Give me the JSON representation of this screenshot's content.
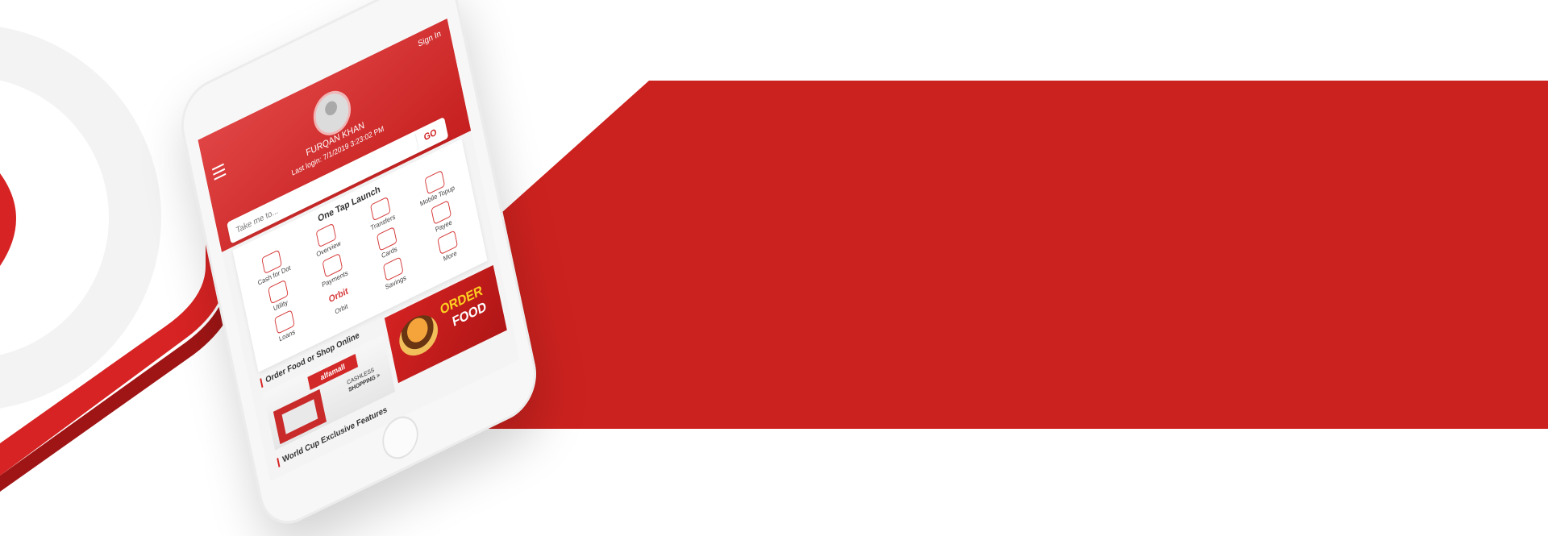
{
  "app": {
    "sign_in": "Sign In",
    "user_name": "FURQAN KHAN",
    "last_login": "Last login: 7/1/2019 3:23:02 PM"
  },
  "search": {
    "placeholder": "Take me to...",
    "go_label": "GO"
  },
  "launch": {
    "title": "One Tap Launch",
    "items": [
      {
        "label": "Cash for Dot",
        "icon": "cash-icon"
      },
      {
        "label": "Overview",
        "icon": "overview-icon"
      },
      {
        "label": "Transfers",
        "icon": "transfers-icon"
      },
      {
        "label": "Mobile Topup",
        "icon": "mobile-topup-icon"
      },
      {
        "label": "Utility",
        "icon": "utility-icon"
      },
      {
        "label": "Payments",
        "icon": "payments-icon"
      },
      {
        "label": "Cards",
        "icon": "cards-icon"
      },
      {
        "label": "Payee",
        "icon": "payee-icon"
      },
      {
        "label": "Loans",
        "icon": "loans-icon"
      },
      {
        "label": "Orbit",
        "icon": "orbit-icon",
        "icon_text": "Orbit"
      },
      {
        "label": "Savings",
        "icon": "savings-icon"
      },
      {
        "label": "More",
        "icon": "more-icon"
      }
    ]
  },
  "sections": {
    "order_food": "Order Food or Shop Online",
    "world_cup": "World Cup Exclusive Features"
  },
  "banners": {
    "food": {
      "line1": "ORDER",
      "line2": "FOOD"
    },
    "mall": {
      "logo": "alfamall",
      "line1": "CASHLESS",
      "line2": "SHOPPING >"
    }
  },
  "colors": {
    "brand_red": "#cc221f",
    "accent_yellow": "#ffd21f"
  }
}
